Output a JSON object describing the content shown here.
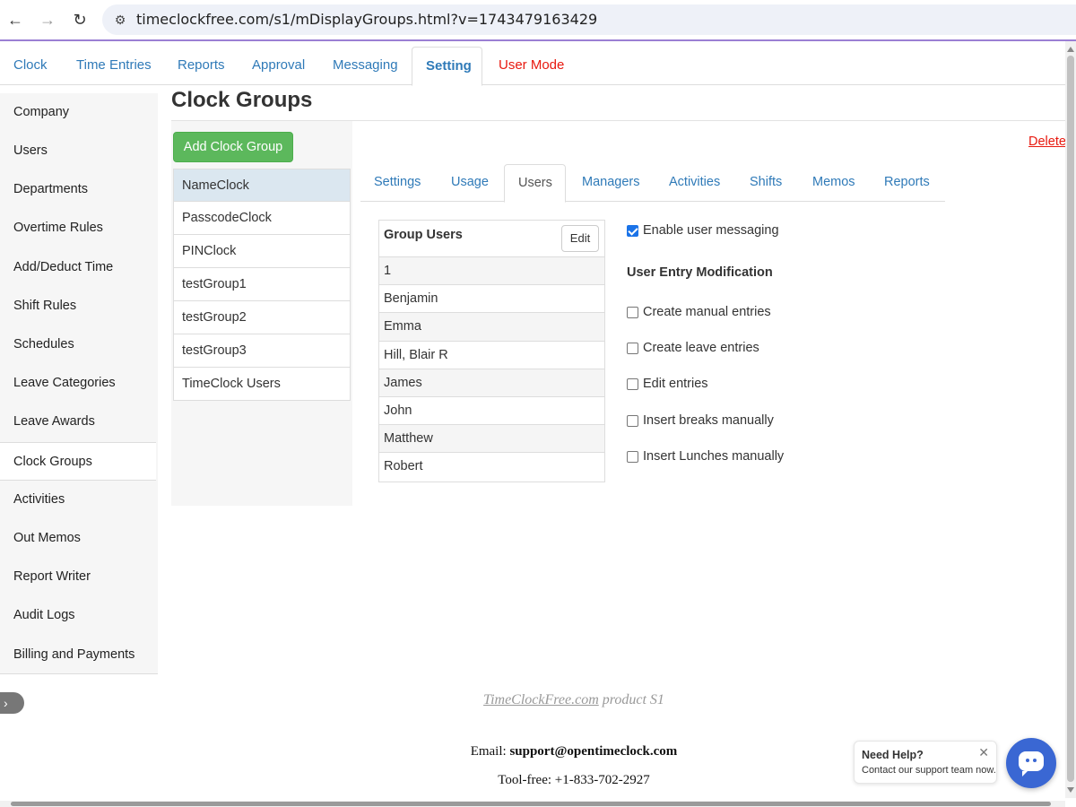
{
  "browser": {
    "url": "timeclockfree.com/s1/mDisplayGroups.html?v=1743479163429",
    "back_icon": "←",
    "forward_icon": "→",
    "reload_icon": "↻",
    "site_icon": "⚙"
  },
  "top_tabs": [
    {
      "label": "Clock"
    },
    {
      "label": "Time Entries"
    },
    {
      "label": "Reports"
    },
    {
      "label": "Approval"
    },
    {
      "label": "Messaging"
    },
    {
      "label": "Setting"
    },
    {
      "label": "User Mode"
    }
  ],
  "sidebar": {
    "items": [
      {
        "label": "Company"
      },
      {
        "label": "Users"
      },
      {
        "label": "Departments"
      },
      {
        "label": "Overtime Rules"
      },
      {
        "label": "Add/Deduct Time"
      },
      {
        "label": "Shift Rules"
      },
      {
        "label": "Schedules"
      },
      {
        "label": "Leave Categories"
      },
      {
        "label": "Leave Awards"
      },
      {
        "label": "Clock Groups"
      },
      {
        "label": "Activities"
      },
      {
        "label": "Out Memos"
      },
      {
        "label": "Report Writer"
      },
      {
        "label": "Audit Logs"
      },
      {
        "label": "Billing and Payments"
      }
    ],
    "toggle_icon": "›"
  },
  "main": {
    "title": "Clock Groups",
    "add_button": "Add Clock Group",
    "delete_link": "Delete",
    "groups": [
      {
        "label": "NameClock"
      },
      {
        "label": "PasscodeClock"
      },
      {
        "label": "PINClock"
      },
      {
        "label": "testGroup1"
      },
      {
        "label": "testGroup2"
      },
      {
        "label": "testGroup3"
      },
      {
        "label": "TimeClock Users"
      }
    ],
    "sub_tabs": [
      {
        "label": "Settings"
      },
      {
        "label": "Usage"
      },
      {
        "label": "Users"
      },
      {
        "label": "Managers"
      },
      {
        "label": "Activities"
      },
      {
        "label": "Shifts"
      },
      {
        "label": "Memos"
      },
      {
        "label": "Reports"
      }
    ],
    "users_table": {
      "header": "Group Users",
      "edit_button": "Edit",
      "rows": [
        "1",
        "Benjamin",
        "Emma",
        "Hill, Blair R",
        "James",
        "John",
        "Matthew",
        "Robert"
      ]
    },
    "options": {
      "enable_messaging": {
        "label": "Enable user messaging",
        "checked": true
      },
      "heading": "User Entry Modification",
      "create_manual": {
        "label": "Create manual entries",
        "checked": false
      },
      "create_leave": {
        "label": "Create leave entries",
        "checked": false
      },
      "edit_entries": {
        "label": "Edit entries",
        "checked": false
      },
      "insert_breaks": {
        "label": "Insert breaks manually",
        "checked": false
      },
      "insert_lunches": {
        "label": "Insert Lunches manually",
        "checked": false
      }
    }
  },
  "footer": {
    "product_link": "TimeClockFree.com",
    "product_suffix": " product S1",
    "email_label": "Email: ",
    "email": "support@opentimeclock.com",
    "phone": "Tool-free: +1-833-702-2927"
  },
  "help": {
    "title": "Need Help?",
    "subtitle": "Contact our support team now.",
    "close": "✕"
  },
  "colors": {
    "link_blue": "#2f7ab8",
    "red": "#e8190f",
    "green_button": "#5cb85c",
    "active_group": "#dbe7f0",
    "help_bubble": "#3a67d3"
  }
}
